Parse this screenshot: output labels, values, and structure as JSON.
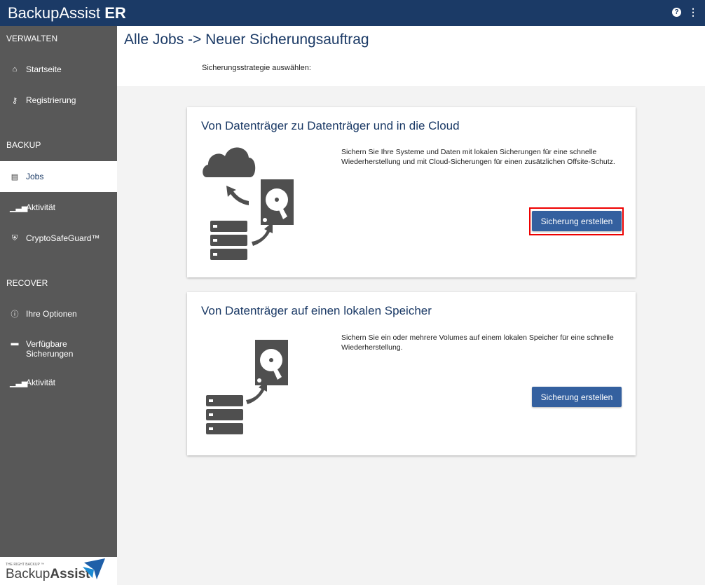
{
  "header": {
    "brand": "BackupAssist",
    "brand_bold": "ER"
  },
  "sidebar": {
    "sections": [
      "VERWALTEN",
      "BACKUP",
      "RECOVER"
    ],
    "items": [
      {
        "label": "Startseite",
        "icon": "home-icon"
      },
      {
        "label": "Registrierung",
        "icon": "key-icon"
      },
      {
        "label": "Jobs",
        "icon": "clipboard-icon",
        "active": true
      },
      {
        "label": "Aktivität",
        "icon": "chart-icon"
      },
      {
        "label": "CryptoSafeGuard™",
        "icon": "shield-icon"
      },
      {
        "label": "Ihre Optionen",
        "icon": "info-icon"
      },
      {
        "label": "Verfügbare Sicherungen",
        "icon": "drive-icon"
      },
      {
        "label": "Aktivität",
        "icon": "chart-icon"
      }
    ],
    "logo": {
      "tagline": "THE RIGHT BACKUP ™",
      "name": "Backup",
      "name_bold": "Assist"
    }
  },
  "page": {
    "title": "Alle Jobs -> Neuer Sicherungsauftrag",
    "subtitle": "Sicherungsstrategie auswählen:"
  },
  "cards": [
    {
      "title": "Von Datenträger zu Datenträger und in die Cloud",
      "description": "Sichern Sie Ihre Systeme und Daten mit lokalen Sicherungen für eine schnelle Wiederherstellung und mit Cloud-Sicherungen für einen zusätzlichen Offsite-Schutz.",
      "button": "Sicherung erstellen"
    },
    {
      "title": "Von Datenträger auf einen lokalen Speicher",
      "description": "Sichern Sie ein oder mehrere Volumes auf einem lokalen Speicher für eine schnelle Wiederherstellung.",
      "button": "Sicherung erstellen"
    }
  ],
  "colors": {
    "header": "#1b3a66",
    "sidebar": "#585858",
    "button": "#34609f",
    "highlight": "#e00000"
  }
}
